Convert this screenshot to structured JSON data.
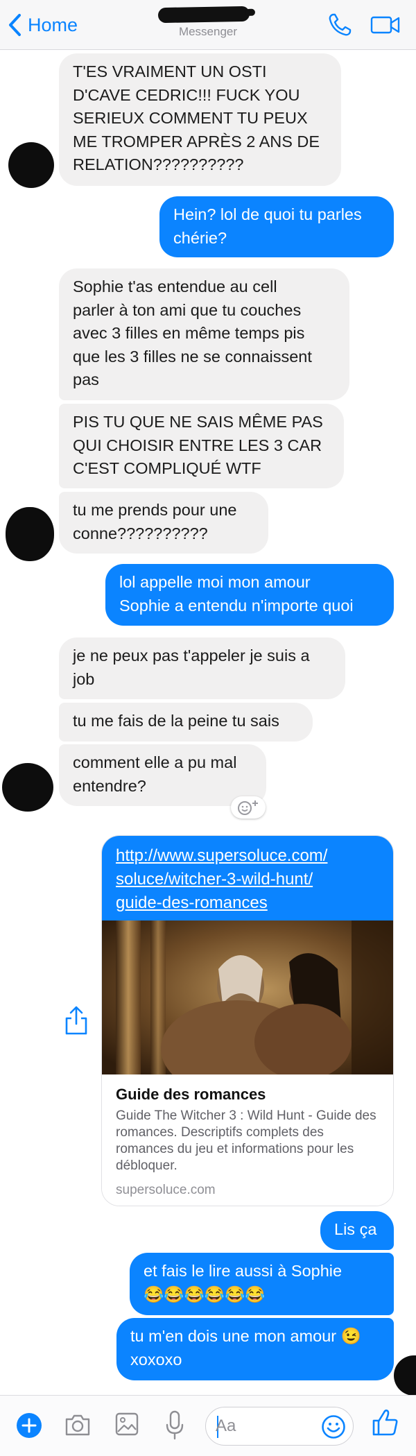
{
  "header": {
    "back_label": "Home",
    "subtitle": "Messenger"
  },
  "messages": [
    {
      "direction": "incoming",
      "text": "T'ES VRAIMENT UN OSTI\nD'CAVE CEDRIC!!! FUCK YOU\nSERIEUX COMMENT TU PEUX\nME TROMPER APRÈS 2 ANS DE\nRELATION??????????"
    },
    {
      "direction": "outgoing",
      "text": "Hein? lol de quoi tu parles\nchérie?"
    },
    {
      "direction": "incoming",
      "text": "Sophie t'as entendue au cell\nparler à ton ami que tu couches\navec 3 filles en même temps pis\nque les 3 filles ne se connaissent\npas"
    },
    {
      "direction": "incoming",
      "text": "PIS TU QUE NE SAIS MÊME PAS\nQUI CHOISIR ENTRE LES 3 CAR\nC'EST COMPLIQUÉ WTF"
    },
    {
      "direction": "incoming",
      "text": "tu me prends pour une\nconne??????????"
    },
    {
      "direction": "outgoing",
      "text": "lol appelle moi mon amour\nSophie a entendu n'importe quoi"
    },
    {
      "direction": "incoming",
      "text": "je ne peux pas t'appeler je suis a\njob"
    },
    {
      "direction": "incoming",
      "text": "tu me fais de la peine tu sais"
    },
    {
      "direction": "incoming",
      "text": "comment elle a pu mal\nentendre?"
    },
    {
      "direction": "outgoing",
      "text": "Lis ça"
    },
    {
      "direction": "outgoing",
      "text": "et fais le lire aussi à Sophie\n😂😂😂😂😂😂"
    },
    {
      "direction": "outgoing",
      "text": "tu m'en dois une mon amour 😉\nxoxoxo"
    }
  ],
  "link_card": {
    "url_lines": [
      "http://www.supersoluce.com/",
      "soluce/witcher-3-wild-hunt/",
      "guide-des-romances"
    ],
    "title": "Guide des romances",
    "description": "Guide The Witcher 3 : Wild Hunt - Guide des romances. Descriptifs complets des romances du jeu et informations pour les débloquer.",
    "domain": "supersoluce.com"
  },
  "composer": {
    "placeholder": "Aa"
  },
  "icons": {
    "header": [
      "chevron-left-icon",
      "phone-icon",
      "video-camera-icon"
    ],
    "composer": [
      "plus-icon",
      "camera-icon",
      "photo-icon",
      "microphone-icon",
      "emoji-icon",
      "thumbs-up-icon"
    ],
    "other": [
      "share-icon",
      "add-reaction-icon"
    ]
  },
  "colors": {
    "accent": "#0B84FF",
    "incoming_bubble": "#F1F0F0",
    "header_bg": "#F7F7F8"
  }
}
